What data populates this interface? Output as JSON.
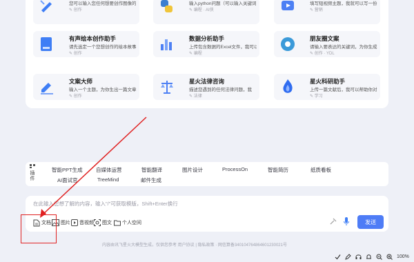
{
  "cards": [
    {
      "title": "",
      "desc": "您可以输入您任何想要创作图像的",
      "meta": "创作"
    },
    {
      "title": "",
      "desc": "输入python问题（可以输入关键词",
      "meta": "编程 · AI侠"
    },
    {
      "title": "",
      "desc": "填写短视频主题，我就可以写一份",
      "meta": "营销"
    },
    {
      "title": "有声绘本创作助手",
      "desc": "请先选定一个您想创作的绘本故事",
      "meta": "创作"
    },
    {
      "title": "数据分析助手",
      "desc": "上传包含数据的Excel文件，我可以",
      "meta": "编程"
    },
    {
      "title": "朋友圈文案",
      "desc": "请输入要表达的关键词，为你生成",
      "meta": "创作 · YDL"
    },
    {
      "title": "文案大师",
      "desc": "输入一个主题，为你生出一篇文章",
      "meta": "创作"
    },
    {
      "title": "星火法律咨询",
      "desc": "描述您遇到的任何法律问题，我",
      "meta": "法律"
    },
    {
      "title": "星火科研助手",
      "desc": "上传一篇文献后，我可以帮助你对",
      "meta": "学习"
    }
  ],
  "plugins": {
    "label": "插件",
    "row1": [
      "智能PPT生成",
      "自媒体运营",
      "智能翻译",
      "图片设计",
      "ProcessOn",
      "智能简历",
      "纸质看板"
    ],
    "row2": [
      "AI面试官",
      "TreeMind",
      "邮件生成"
    ]
  },
  "input": {
    "placeholder": "在此输入您想了解的内容，输入\"/\"可获取模版，Shift+Enter换行"
  },
  "tools": [
    "文档",
    "图片",
    "音视频",
    "图文",
    "个人空间"
  ],
  "send_label": "发送",
  "footer": "内容由讯飞星火大模型生成，仅供您参考    用户协议  |  隐私政策 · 网信算备340104764864601230021号",
  "status": {
    "zoom": "100%"
  }
}
